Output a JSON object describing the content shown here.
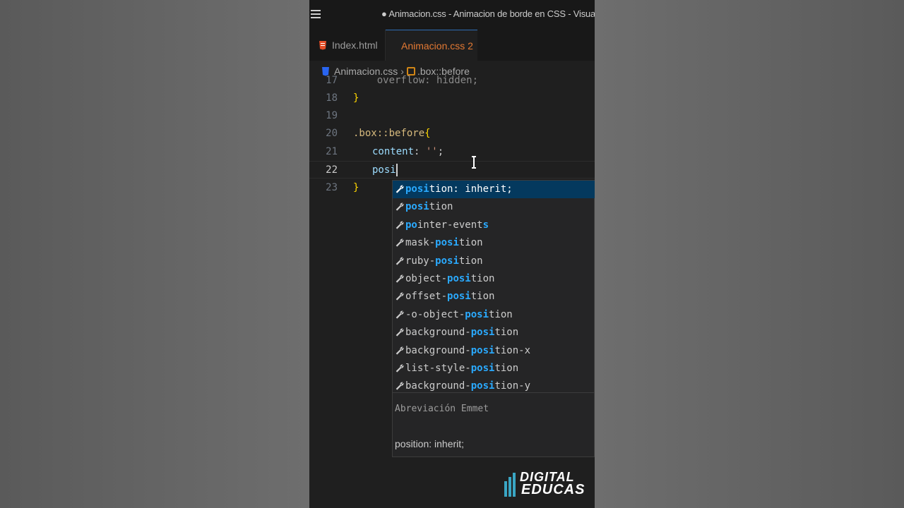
{
  "window": {
    "title": "● Animacion.css - Animacion de borde en CSS - Visual Studio Cod"
  },
  "tabs": [
    {
      "label": "Index.html",
      "icon": "html5-file-icon"
    },
    {
      "label": "Animacion.css 2",
      "icon": "css3-file-icon",
      "modified": true
    }
  ],
  "breadcrumb": {
    "file": "Animacion.css",
    "symbol": ".box::before"
  },
  "editor": {
    "partial_line": "    overflow: hidden;",
    "lines": [
      {
        "num": "17"
      },
      {
        "num": "18",
        "brace": "}"
      },
      {
        "num": "19"
      },
      {
        "num": "20",
        "selector": ".box::before",
        "brace": "{"
      },
      {
        "num": "21",
        "prop": "content",
        "colon": ": ",
        "value": "''",
        "semi": ";"
      },
      {
        "num": "22",
        "typed": "posi"
      },
      {
        "num": "23",
        "brace": "}"
      }
    ]
  },
  "suggestions": {
    "items": [
      {
        "match": "posi",
        "rest": "tion: inherit;"
      },
      {
        "match": "posi",
        "rest": "tion"
      },
      {
        "pre": "",
        "match": "po",
        "rest": "inter-event",
        "tail": "s"
      },
      {
        "pre": "mask-",
        "match": "posi",
        "rest": "tion"
      },
      {
        "pre": "ruby-",
        "match": "posi",
        "rest": "tion"
      },
      {
        "pre": "object-",
        "match": "posi",
        "rest": "tion"
      },
      {
        "pre": "offset-",
        "match": "posi",
        "rest": "tion"
      },
      {
        "pre": "-o-object-",
        "match": "posi",
        "rest": "tion"
      },
      {
        "pre": "background-",
        "match": "posi",
        "rest": "tion"
      },
      {
        "pre": "background-",
        "match": "posi",
        "rest": "tion-x"
      },
      {
        "pre": "list-style-",
        "match": "posi",
        "rest": "tion"
      },
      {
        "pre": "background-",
        "match": "posi",
        "rest": "tion-y"
      }
    ],
    "detail_title": "Abreviación Emmet",
    "detail_body": "position: inherit;"
  },
  "watermark": {
    "top": "DIGITAL",
    "bottom": "EDUCAS"
  }
}
